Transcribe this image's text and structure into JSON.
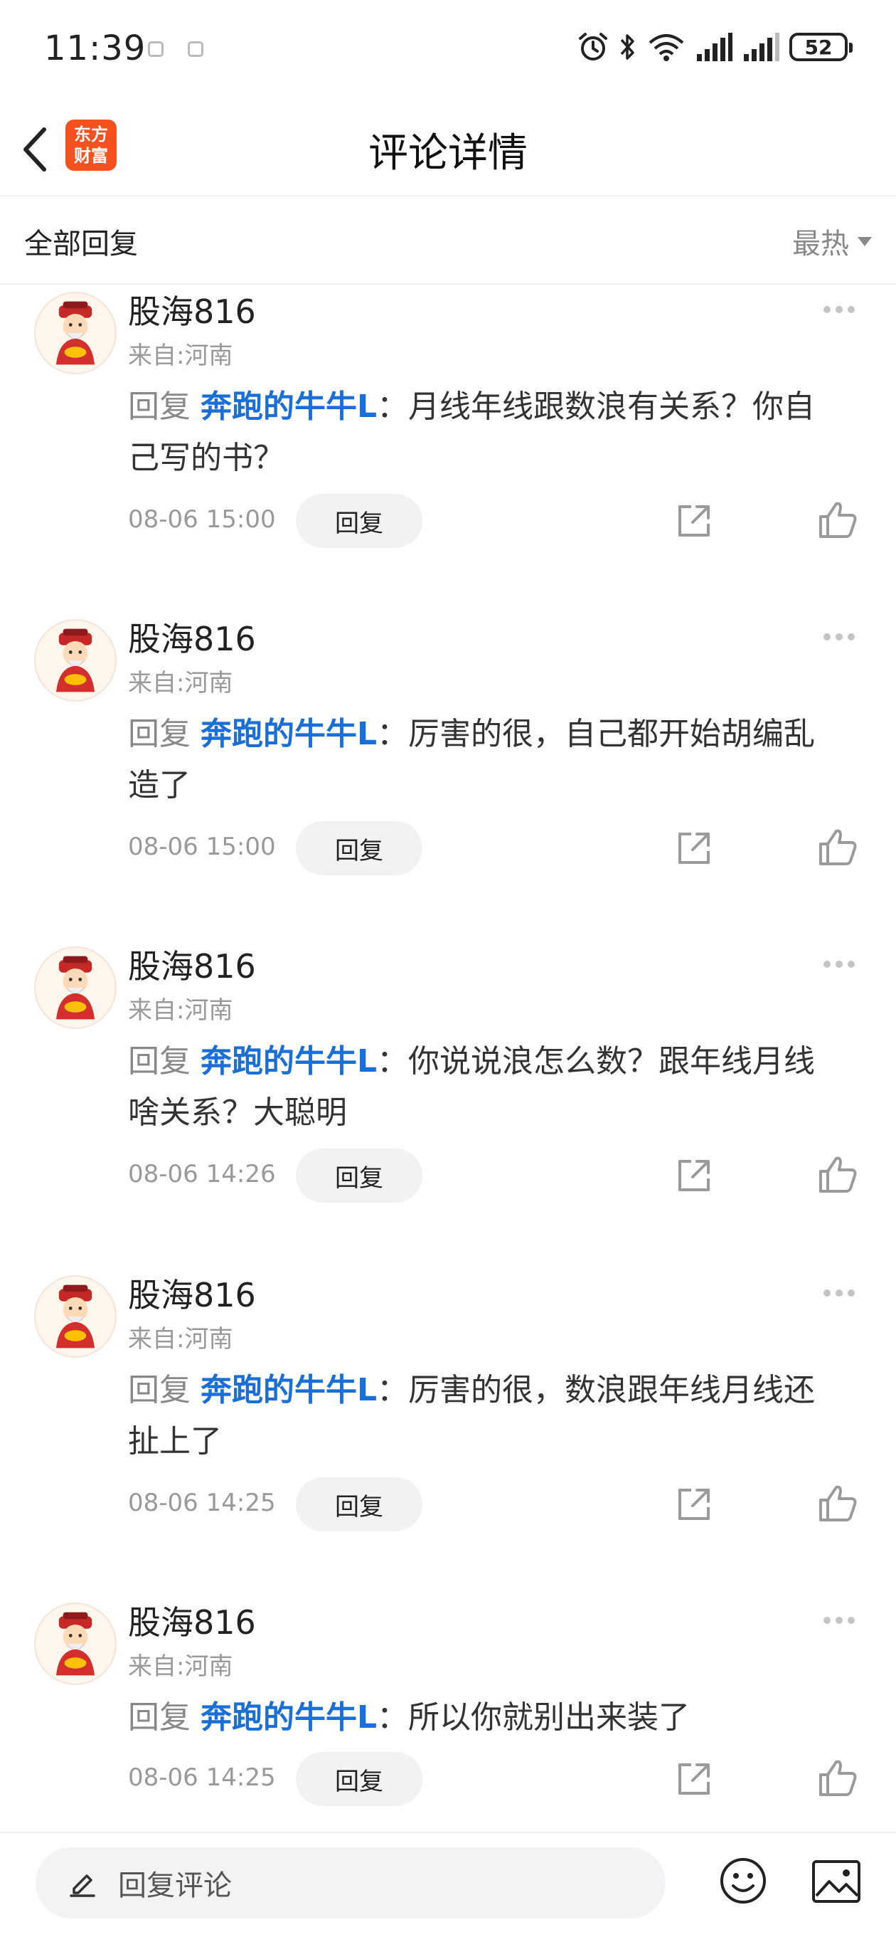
{
  "status_bar": {
    "time": "11:39",
    "battery": "52",
    "icons": [
      "alarm-icon",
      "bluetooth-icon",
      "wifi-icon",
      "signal-icon",
      "signal-icon",
      "battery-icon"
    ]
  },
  "header": {
    "title": "评论详情",
    "logo_line1": "东方",
    "logo_line2": "财富"
  },
  "filter": {
    "all_replies": "全部回复",
    "sort": "最热"
  },
  "colors": {
    "mention": "#1a6ed8",
    "logo": "#f4511e"
  },
  "comments": [
    {
      "username": "股海816",
      "location": "来自:河南",
      "reply_prefix": "回复 ",
      "mention": "奔跑的牛牛L",
      "text": "：月线年线跟数浪有关系？你自己写的书？",
      "date": "08-06 15:00",
      "reply_label": "回复"
    },
    {
      "username": "股海816",
      "location": "来自:河南",
      "reply_prefix": "回复 ",
      "mention": "奔跑的牛牛L",
      "text": "：厉害的很，自己都开始胡编乱造了",
      "date": "08-06 15:00",
      "reply_label": "回复"
    },
    {
      "username": "股海816",
      "location": "来自:河南",
      "reply_prefix": "回复 ",
      "mention": "奔跑的牛牛L",
      "text": "：你说说浪怎么数？跟年线月线啥关系？大聪明",
      "date": "08-06 14:26",
      "reply_label": "回复"
    },
    {
      "username": "股海816",
      "location": "来自:河南",
      "reply_prefix": "回复 ",
      "mention": "奔跑的牛牛L",
      "text": "：厉害的很，数浪跟年线月线还扯上了",
      "date": "08-06 14:25",
      "reply_label": "回复"
    },
    {
      "username": "股海816",
      "location": "来自:河南",
      "reply_prefix": "回复 ",
      "mention": "奔跑的牛牛L",
      "text": "：所以你就别出来装了",
      "date": "08-06 14:25",
      "reply_label": "回复"
    }
  ],
  "bottom_bar": {
    "placeholder": "回复评论"
  }
}
